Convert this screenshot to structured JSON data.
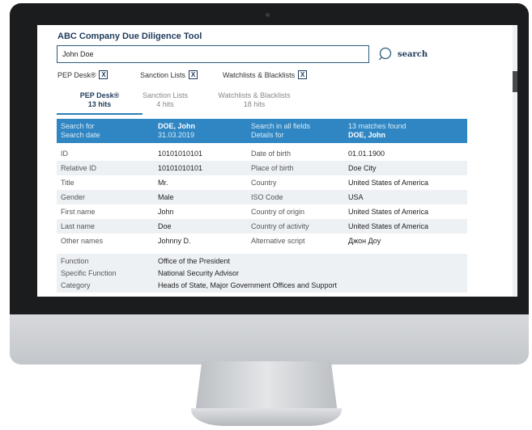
{
  "app": {
    "title": "ABC Company Due Diligence Tool"
  },
  "search": {
    "value": "John Doe",
    "button_label": "search"
  },
  "filters": [
    {
      "label": "PEP Desk®",
      "checked_mark": "X"
    },
    {
      "label": "Sanction Lists",
      "checked_mark": "X"
    },
    {
      "label": "Watchlists & Blacklists",
      "checked_mark": "X"
    }
  ],
  "tabs": [
    {
      "label": "PEP Desk®",
      "count": "13 hits"
    },
    {
      "label": "Sanction Lists",
      "count": "4 hits"
    },
    {
      "label": "Watchlists & Blacklists",
      "count": "18 hits"
    }
  ],
  "summary": {
    "search_for_label": "Search for",
    "search_for_value": "DOE, John",
    "search_date_label": "Search date",
    "search_date_value": "31.03.2019",
    "search_in_label": "Search in all fields",
    "matches_found": "13 matches found",
    "details_for_label": "Details for",
    "details_for_value": "DOE, John"
  },
  "details": [
    {
      "l1": "ID",
      "v1": "10101010101",
      "l2": "Date of birth",
      "v2": "01.01.1900"
    },
    {
      "l1": "Relative ID",
      "v1": "10101010101",
      "l2": "Place of birth",
      "v2": "Doe City"
    },
    {
      "l1": "Title",
      "v1": "Mr.",
      "l2": "Country",
      "v2": "United States of America"
    },
    {
      "l1": "Gender",
      "v1": "Male",
      "l2": "ISO Code",
      "v2": "USA"
    },
    {
      "l1": "First name",
      "v1": "John",
      "l2": "Country of origin",
      "v2": "United States of America"
    },
    {
      "l1": "Last name",
      "v1": "Doe",
      "l2": "Country of activity",
      "v2": "United States of America"
    },
    {
      "l1": "Other names",
      "v1": "Johnny D.",
      "l2": "Alternative script",
      "v2": "Джон Доу"
    }
  ],
  "function_block": [
    {
      "label": "Function",
      "value": "Office of the President"
    },
    {
      "label": "Specific Function",
      "value": "National Security Advisor"
    },
    {
      "label": "Category",
      "value": "Heads of State, Major Government Offices and Support"
    }
  ],
  "colors": {
    "accent": "#2f86c3",
    "title": "#1f3b5b",
    "row_alt": "#eef1f4"
  },
  "icons": {
    "search": "search-icon"
  }
}
